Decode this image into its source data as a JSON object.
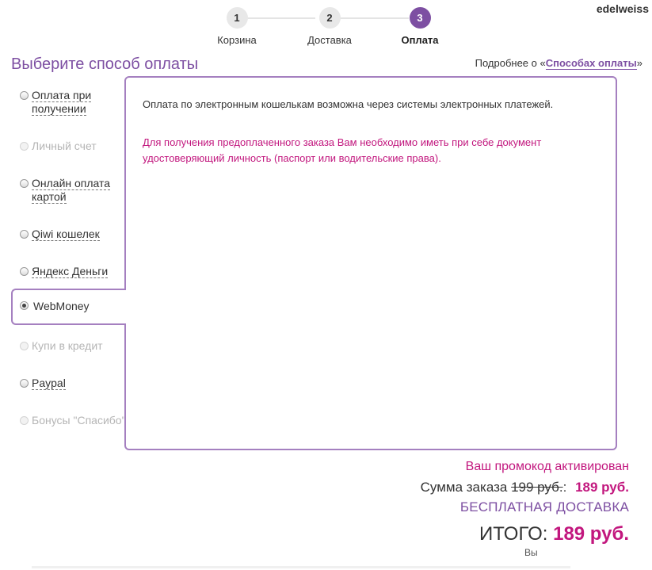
{
  "header": {
    "username": "edelweiss"
  },
  "steps": [
    {
      "number": "1",
      "label": "Корзина"
    },
    {
      "number": "2",
      "label": "Доставка"
    },
    {
      "number": "3",
      "label": "Оплата"
    }
  ],
  "page_title": "Выберите способ оплаты",
  "more_info": {
    "prefix": "Подробнее о «",
    "link": "Способах оплаты",
    "suffix": "»"
  },
  "methods": [
    {
      "label": "Оплата при получении",
      "state": "enabled"
    },
    {
      "label": "Личный счет",
      "state": "disabled"
    },
    {
      "label": "Онлайн оплата картой",
      "state": "enabled"
    },
    {
      "label": "Qiwi кошелек",
      "state": "enabled"
    },
    {
      "label": "Яндекс Деньги",
      "state": "enabled"
    },
    {
      "label": "WebMoney",
      "state": "selected"
    },
    {
      "label": "Купи в кредит",
      "state": "disabled"
    },
    {
      "label": "Paypal",
      "state": "enabled"
    },
    {
      "label": "Бонусы \"Спасибо\"",
      "state": "disabled"
    }
  ],
  "panel": {
    "text1": "Оплата по электронным кошелькам возможна через системы электронных платежей.",
    "text2": "Для получения предоплаченного заказа Вам необходимо иметь при себе документ удостоверяющий личность (паспорт или водительские права)."
  },
  "summary": {
    "promo": "Ваш промокод активирован",
    "sum_label": "Сумма заказа",
    "old_price": "199 руб.",
    "colon": ":",
    "new_price": "189 руб.",
    "free_delivery": "БЕСПЛАТНАЯ ДОСТАВКА",
    "total_label": "ИТОГО:",
    "total_amount": "189 руб.",
    "cutoff_text": "Вы"
  },
  "colors": {
    "accent": "#7d4fa2",
    "highlight": "#c2177e",
    "border": "#a580c0"
  }
}
